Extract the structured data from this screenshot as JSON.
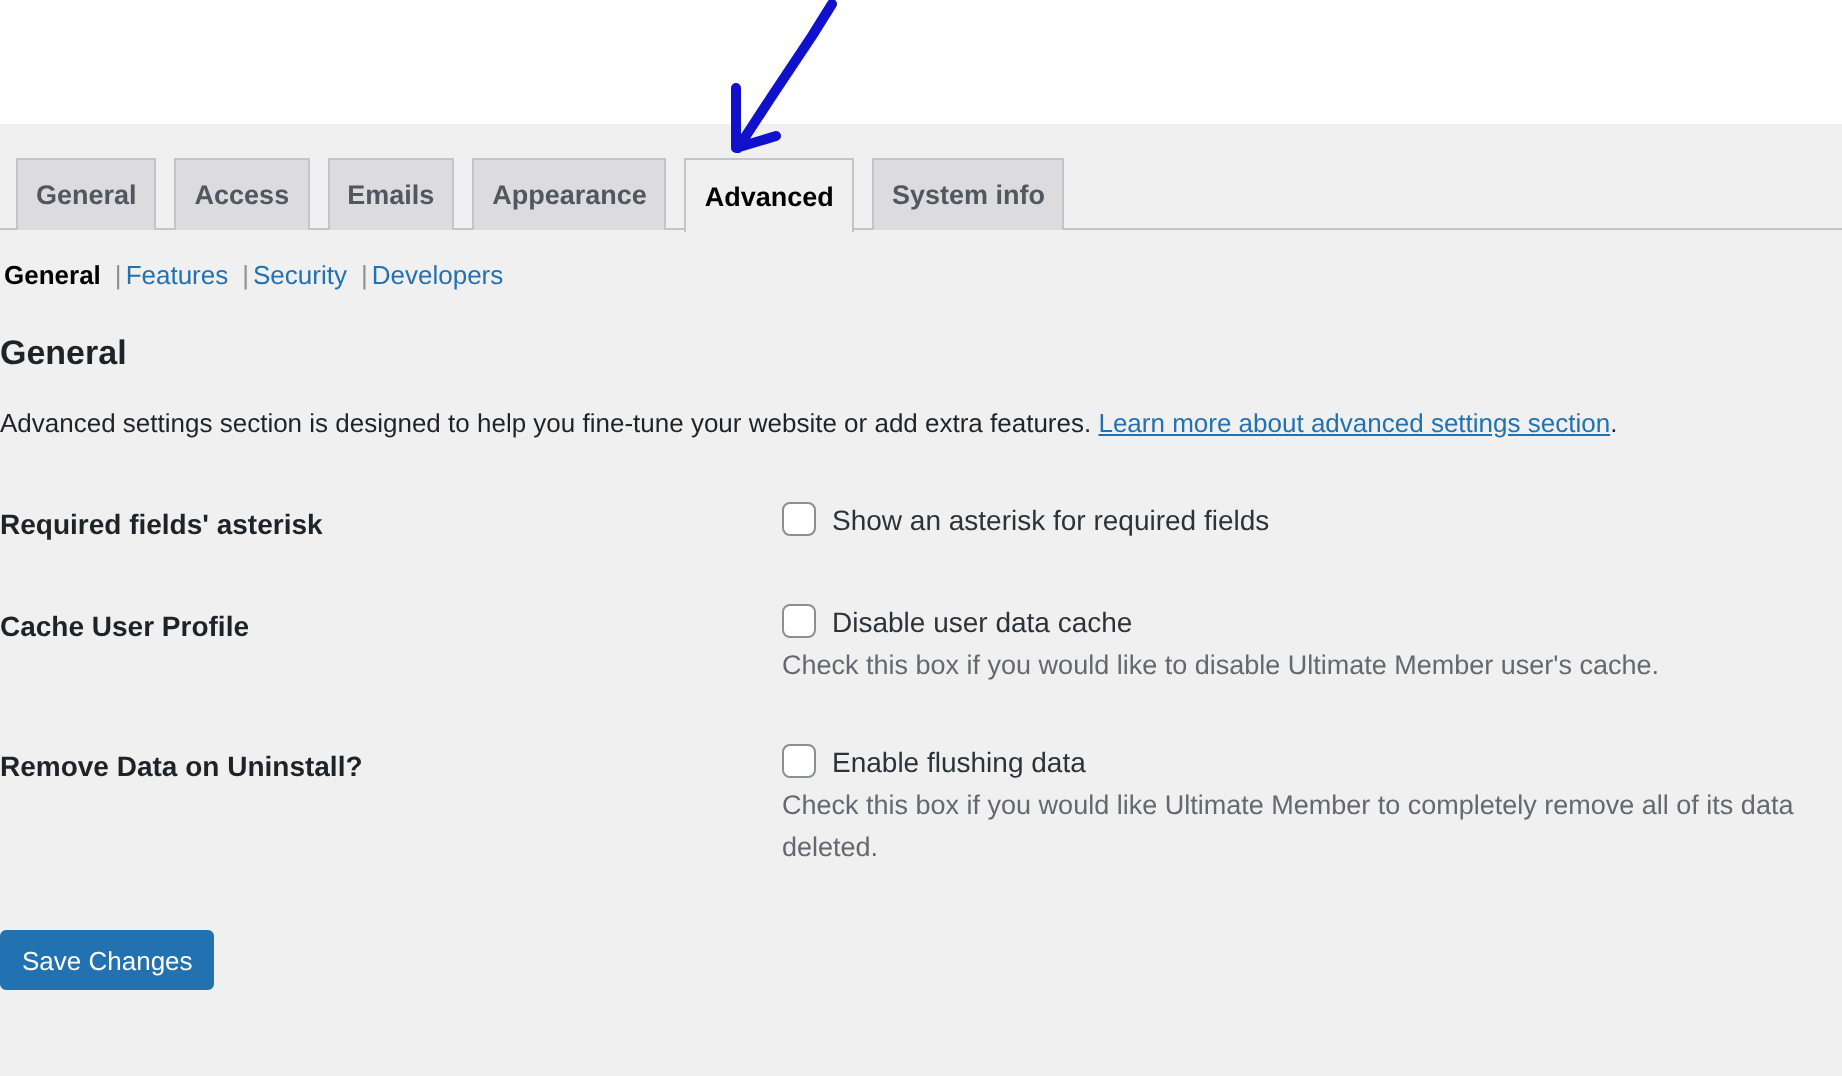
{
  "tabs": [
    {
      "label": "General",
      "selected": false
    },
    {
      "label": "Access",
      "selected": false
    },
    {
      "label": "Emails",
      "selected": false
    },
    {
      "label": "Appearance",
      "selected": false
    },
    {
      "label": "Advanced",
      "selected": true
    },
    {
      "label": "System info",
      "selected": false
    }
  ],
  "subnav": [
    {
      "label": "General",
      "selected": true
    },
    {
      "separator": "|",
      "label": "Features",
      "selected": false
    },
    {
      "separator": "|",
      "label": "Security",
      "selected": false
    },
    {
      "separator": "|",
      "label": "Developers",
      "selected": false
    }
  ],
  "section": {
    "title": "General",
    "description": "Advanced settings section is designed to help you fine-tune your website or add extra features.",
    "link": "Learn more about advanced settings section",
    "after_link": "."
  },
  "settings": [
    {
      "label": "Required fields' asterisk",
      "option": "Show an asterisk for required fields",
      "checked": false
    },
    {
      "label": "Cache User Profile",
      "option": "Disable user data cache",
      "checked": false,
      "help": [
        "Check this box if you would like to disable Ultimate Member user's cache."
      ]
    },
    {
      "label": "Remove Data on Uninstall?",
      "option": "Enable flushing data",
      "checked": false,
      "help": [
        "Check this box if you would like Ultimate Member to completely remove all of its data",
        "deleted."
      ]
    }
  ],
  "save_button": "Save Changes"
}
